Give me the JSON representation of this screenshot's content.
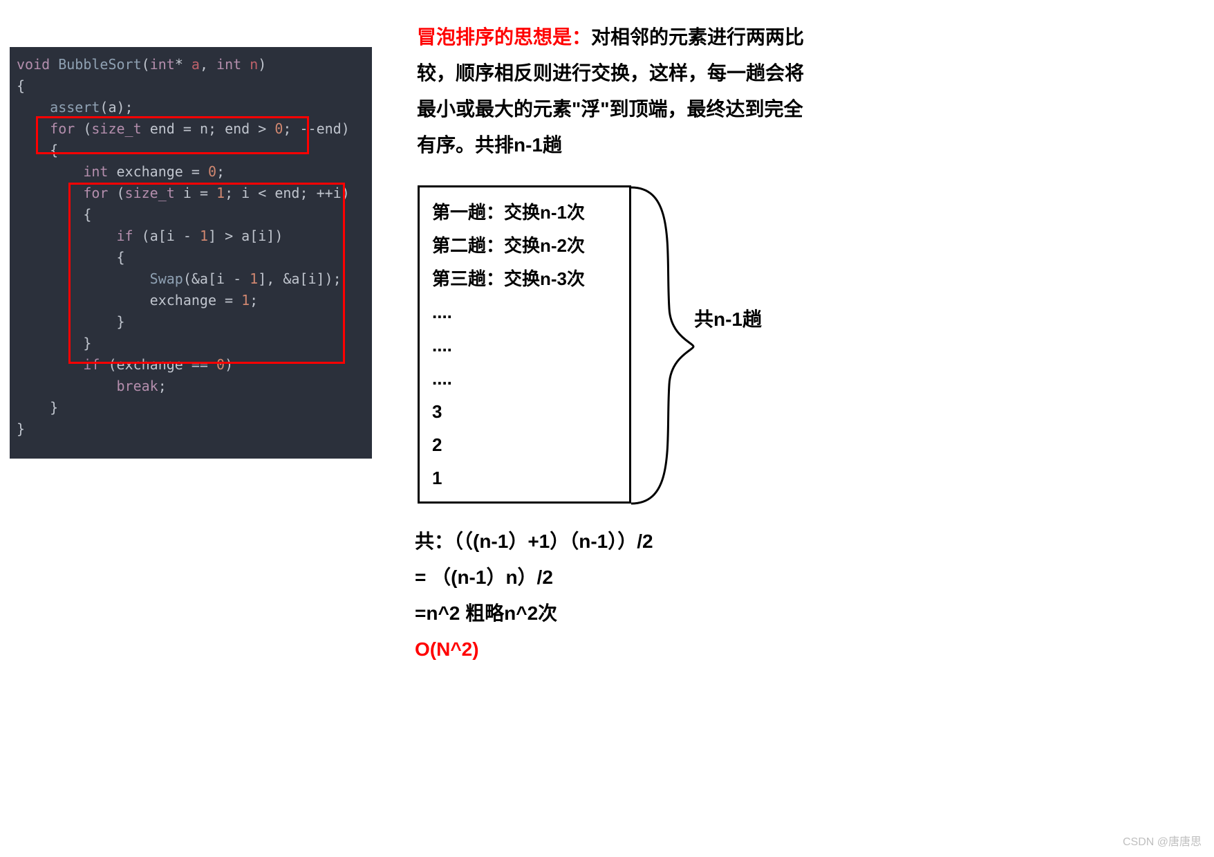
{
  "code": {
    "l1_void": "void",
    "l1_fn": "BubbleSort",
    "l1_p1t": "int",
    "l1_p1s": "*",
    "l1_p1n": "a",
    "l1_comma": ",",
    "l1_p2t": "int",
    "l1_p2n": "n",
    "l2": "{",
    "l3_fn": "assert",
    "l3_arg": "a",
    "l4_for": "for",
    "l4_lp": "(",
    "l4_t": "size_t",
    "l4_v": "end",
    "l4_eq": "=",
    "l4_n": "n",
    "l4_sc1": ";",
    "l4_cond": "end > ",
    "l4_zero": "0",
    "l4_sc2": ";",
    "l4_dec": "--end",
    "l4_rp": ")",
    "l5": "{",
    "l6_t": "int",
    "l6_v": "exchange",
    "l6_eq": "=",
    "l6_z": "0",
    "l7_for": "for",
    "l7_lp": "(",
    "l7_t": "size_t",
    "l7_v": "i",
    "l7_eq": "=",
    "l7_one": "1",
    "l7_sc1": ";",
    "l7_cond": "i < end",
    "l7_sc2": ";",
    "l7_inc": "++i",
    "l7_rp": ")",
    "l8": "{",
    "l9_if": "if",
    "l9_lp": "(",
    "l9_a1": "a[i - ",
    "l9_one": "1",
    "l9_a2": "] > a[i]",
    "l9_rp": ")",
    "l10": "{",
    "l11_fn": "Swap",
    "l11_a1": "(&a[i - ",
    "l11_one": "1",
    "l11_a2": "], &a[i]);",
    "l12_v": "exchange = ",
    "l12_one": "1",
    "l12_sc": ";",
    "l13": "}",
    "l14": "}",
    "l15_if": "if",
    "l15_cond": "(exchange == ",
    "l15_z": "0",
    "l15_rp": ")",
    "l16_break": "break",
    "l16_sc": ";",
    "l17": "}",
    "l18": "}"
  },
  "desc": {
    "lead": "冒泡排序的思想是：",
    "body": "对相邻的元素进行两两比较，顺序相反则进行交换，这样，每一趟会将最小或最大的元素\"浮\"到顶端，最终达到完全有序。共排n-1趟"
  },
  "diagram": {
    "rows": [
      "第一趟：交换n-1次",
      "第二趟：交换n-2次",
      "第三趟：交换n-3次",
      "....",
      "....",
      "....",
      "3",
      "2",
      "1"
    ],
    "brace_label": "共n-1趟"
  },
  "formula": {
    "line1": "共：（（(n-1）+1）（n-1））/2",
    "line2": "= （(n-1）n）/2",
    "line3": "=n^2 粗略n^2次",
    "line4": "O(N^2)"
  },
  "watermark": "CSDN @唐唐思"
}
